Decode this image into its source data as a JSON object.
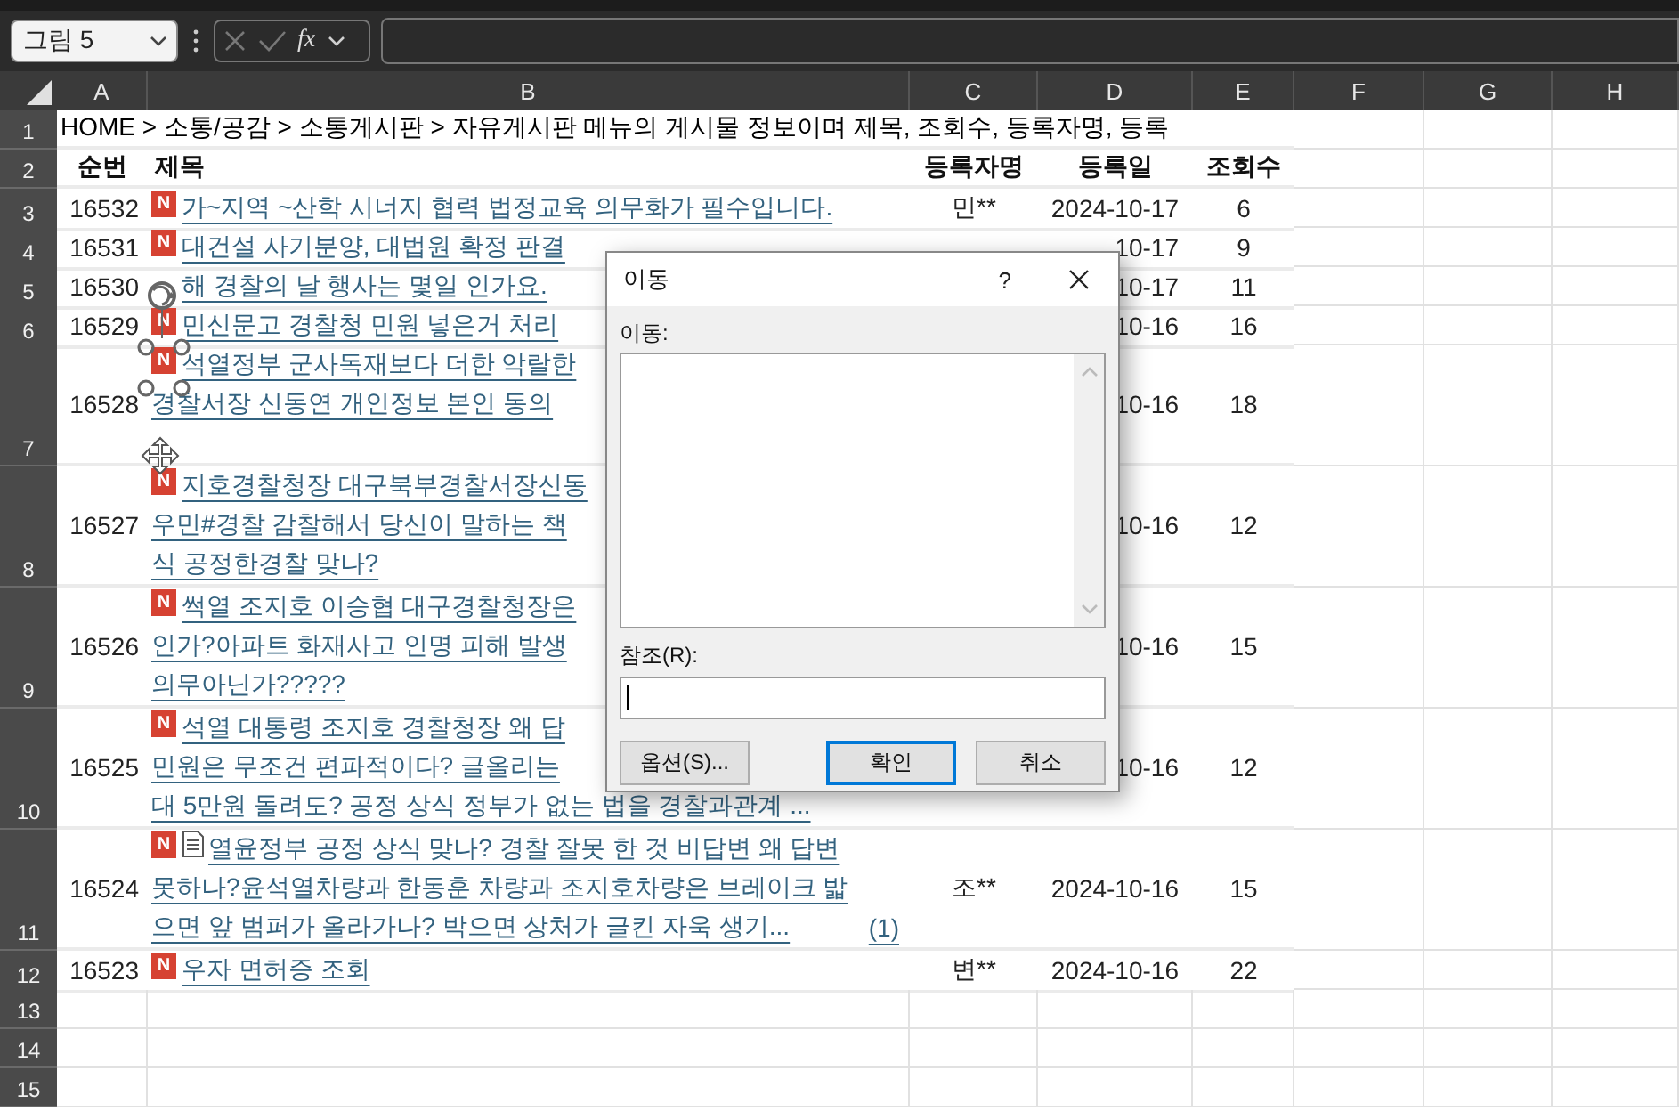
{
  "name_box": {
    "value": "그림 5"
  },
  "formula_bar": {
    "function_label": "fx"
  },
  "columns": [
    "A",
    "B",
    "C",
    "D",
    "E",
    "F",
    "G",
    "H"
  ],
  "rows": [
    {
      "number": "1",
      "kind": "breadcrumb",
      "text": "HOME > 소통/공감 > 소통게시판 > 자유게시판 메뉴의 게시물 정보이며 제목, 조회수, 등록자명, 등록"
    },
    {
      "number": "2",
      "kind": "header",
      "cells": [
        "순번",
        "제목",
        "등록자명",
        "등록일",
        "조회수"
      ]
    },
    {
      "number": "3",
      "kind": "post",
      "seq": "16532",
      "badge": "N",
      "attachment": false,
      "lines": [
        "가~지역 ~산학 시너지 협력 법정교육 의무화가 필수입니다."
      ],
      "author": "민**",
      "date": "2024-10-17",
      "views": "6"
    },
    {
      "number": "4",
      "kind": "post",
      "seq": "16531",
      "badge": "N",
      "attachment": false,
      "lines": [
        "대건설 사기분양, 대법원 확정 판결"
      ],
      "date": "10-17",
      "views": "9"
    },
    {
      "number": "5",
      "kind": "post",
      "seq": "16530",
      "attachment": false,
      "lines": [
        "해 경찰의 날 행사는 몇일 인가요."
      ],
      "date": "10-17",
      "views": "11"
    },
    {
      "number": "6",
      "kind": "post",
      "seq": "16529",
      "badge": "N",
      "attachment": false,
      "lines": [
        "민신문고 경찰청 민원 넣은거 처리"
      ],
      "date": "10-16",
      "views": "16"
    },
    {
      "number": "7",
      "kind": "post",
      "seq": "16528",
      "badge": "N",
      "attachment": false,
      "lines": [
        "석열정부 군사독재보다 더한 악랄한",
        "경찰서장 신동연 개인정보 본인 동의"
      ],
      "date": "10-16",
      "views": "18"
    },
    {
      "number": "8",
      "kind": "post",
      "seq": "16527",
      "badge": "N",
      "attachment": false,
      "lines": [
        "지호경찰청장 대구북부경찰서장신동",
        "우민#경찰 감찰해서 당신이 말하는 책",
        "식 공정한경찰 맞나?"
      ],
      "date": "10-16",
      "views": "12"
    },
    {
      "number": "9",
      "kind": "post",
      "seq": "16526",
      "badge": "N",
      "attachment": false,
      "lines": [
        "썩열 조지호 이승협 대구경찰청장은",
        "인가?아파트 화재사고 인명 피해 발생",
        "의무아닌가?????"
      ],
      "date": "10-16",
      "views": "15"
    },
    {
      "number": "10",
      "kind": "post",
      "seq": "16525",
      "badge": "N",
      "attachment": false,
      "lines": [
        "석열 대통령 조지호 경찰청장 왜 답",
        "민원은 무조건 편파적이다? 글올리는",
        "대 5만원 돌려도? 공정 상식 정부가 없는 법을 경찰과관계 ..."
      ],
      "date": "10-16",
      "views": "12"
    },
    {
      "number": "11",
      "kind": "post",
      "seq": "16524",
      "badge": "N",
      "attachment": true,
      "lines": [
        "열윤정부 공정 상식 맞나? 경찰 잘못 한 것 비답변 왜 답변",
        "못하나?윤석열차량과 한동훈 차량과 조지호차량은 브레이크 밟",
        "으면 앞 범퍼가 올라가나? 박으면 상처가 글킨 자욱 생기..."
      ],
      "comment_count": "(1)",
      "author": "조**",
      "date": "2024-10-16",
      "views": "15"
    },
    {
      "number": "12",
      "kind": "post",
      "seq": "16523",
      "badge": "N",
      "attachment": false,
      "lines": [
        "우자 면허증 조회"
      ],
      "author": "변**",
      "date": "2024-10-16",
      "views": "22"
    },
    {
      "number": "13",
      "kind": "empty"
    },
    {
      "number": "14",
      "kind": "empty"
    },
    {
      "number": "15",
      "kind": "empty"
    }
  ],
  "dialog": {
    "title": "이동",
    "help": "?",
    "list_label": "이동:",
    "reference_label": "참조(R):",
    "buttons": [
      {
        "label": "옵션(S)...",
        "default": false
      },
      {
        "label": "확인",
        "default": true
      },
      {
        "label": "취소",
        "default": false
      }
    ]
  }
}
